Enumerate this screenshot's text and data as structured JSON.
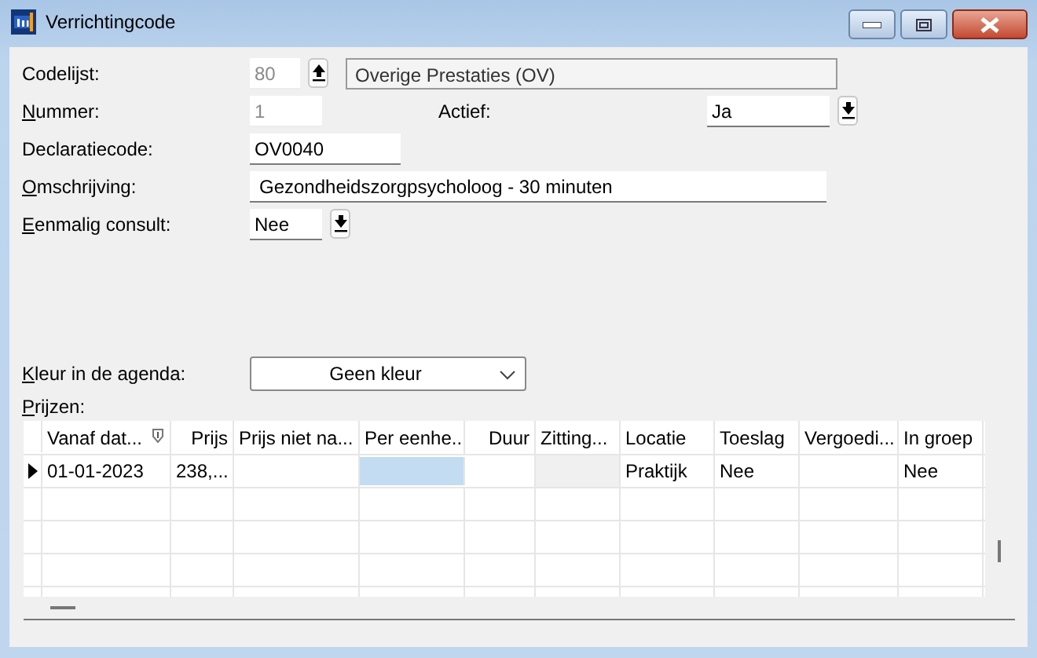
{
  "window": {
    "title": "Verrichtingcode"
  },
  "form": {
    "rows": [
      {
        "label": "Codelijst:",
        "mnemonic": false,
        "kind": "codelist",
        "readonly": true,
        "code": "80",
        "name": "Overige Prestaties (OV)"
      },
      {
        "label": "Nummer:",
        "mnemonic": true,
        "kind": "number",
        "readonly": true,
        "value": "1",
        "side_label": "Actief:",
        "side_value": "Ja"
      },
      {
        "label": "Declaratiecode:",
        "mnemonic": false,
        "kind": "text",
        "readonly": false,
        "value": "OV0040"
      },
      {
        "label": "Omschrijving:",
        "mnemonic": true,
        "kind": "wide",
        "readonly": false,
        "value": "Gezondheidszorgpsycholoog - 30 minuten"
      },
      {
        "label": "Eenmalig consult:",
        "mnemonic": true,
        "kind": "choice",
        "readonly": false,
        "value": "Nee"
      }
    ]
  },
  "color_row": {
    "label": "Kleur in de agenda:",
    "mnemonic": true,
    "value": "Geen kleur"
  },
  "prices": {
    "label": "Prijzen:",
    "mnemonic": true,
    "columns": [
      {
        "label": "Vanaf dat...",
        "sorted": true
      },
      {
        "label": "Prijs",
        "sorted": false
      },
      {
        "label": "Prijs niet na...",
        "sorted": false
      },
      {
        "label": "Per eenhe...",
        "sorted": false
      },
      {
        "label": "Duur",
        "sorted": false
      },
      {
        "label": "Zitting...",
        "sorted": false
      },
      {
        "label": "Locatie",
        "sorted": false
      },
      {
        "label": "Toeslag",
        "sorted": false
      },
      {
        "label": "Vergoedi...",
        "sorted": false
      },
      {
        "label": "In groep",
        "sorted": false
      }
    ],
    "rows": [
      {
        "current": true,
        "cells": [
          {
            "text": "01-01-2023",
            "selected": false,
            "readonly": false
          },
          {
            "text": "238,...",
            "selected": false,
            "readonly": false
          },
          {
            "selected": false,
            "readonly": false
          },
          {
            "selected": true,
            "readonly": false
          },
          {
            "selected": false,
            "readonly": false
          },
          {
            "selected": false,
            "readonly": true
          },
          {
            "text": "Praktijk",
            "selected": false,
            "readonly": false
          },
          {
            "text": "Nee",
            "selected": false,
            "readonly": false
          },
          {
            "selected": false,
            "readonly": false
          },
          {
            "text": "Nee",
            "selected": false,
            "readonly": false
          }
        ]
      }
    ]
  }
}
